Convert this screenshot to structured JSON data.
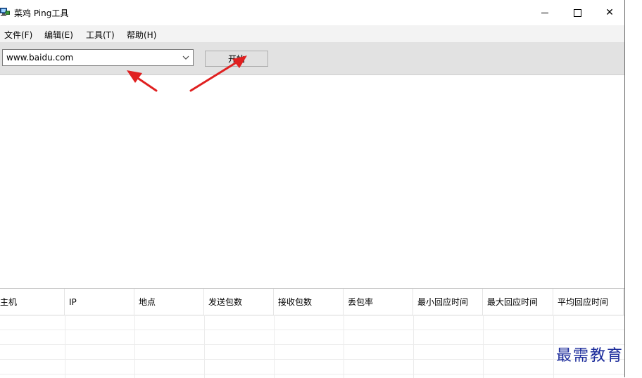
{
  "window": {
    "title": "菜鸡 Ping工具",
    "app_icon": "network-computer-icon",
    "minimize_icon": "minimize-icon",
    "maximize_icon": "maximize-icon",
    "close_icon": "close-icon",
    "close_label": "✕"
  },
  "menu": {
    "items": [
      {
        "label": "文件(F)"
      },
      {
        "label": "编辑(E)"
      },
      {
        "label": "工具(T)"
      },
      {
        "label": "帮助(H)"
      }
    ]
  },
  "toolbar": {
    "host_value": "www.baidu.com",
    "dropdown_icon": "chevron-down-icon",
    "start_label": "开始"
  },
  "table": {
    "columns": [
      "主机",
      "IP",
      "地点",
      "发送包数",
      "接收包数",
      "丢包率",
      "最小回应时间",
      "最大回应时间",
      "平均回应时间"
    ],
    "rows": [
      [],
      [],
      [],
      []
    ]
  },
  "annotations": {
    "arrow_color": "#e02020"
  },
  "watermark": "最需教育"
}
